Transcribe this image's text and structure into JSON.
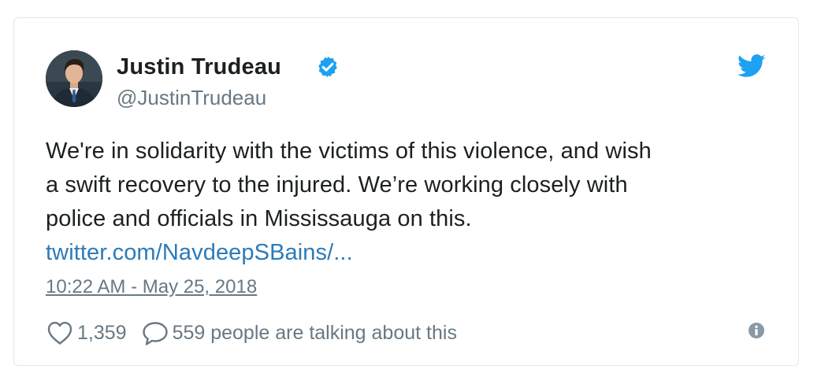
{
  "colors": {
    "brand_blue": "#1da1f2",
    "link_blue": "#2b7bb9",
    "text_dark": "#1c2022",
    "text_grey": "#697882",
    "border": "#e1e8ed"
  },
  "tweet": {
    "author": {
      "name": "Justin Trudeau",
      "handle": "@JustinTrudeau",
      "verified": true,
      "avatar_icon": "profile-photo"
    },
    "text_lines": [
      "We're in solidarity with the victims of this violence, and wish",
      "a swift recovery to the injured. We’re working closely with",
      "police and officials in Mississauga on this."
    ],
    "link_text": "twitter.com/NavdeepSBains/...",
    "timestamp": "10:22 AM - May 25, 2018",
    "likes": "1,359",
    "replies_text": "559 people are talking about this",
    "icons": {
      "brand": "twitter-bird-icon",
      "verified": "verified-badge-icon",
      "like": "heart-icon",
      "reply": "speech-bubble-icon",
      "info": "info-icon"
    }
  }
}
